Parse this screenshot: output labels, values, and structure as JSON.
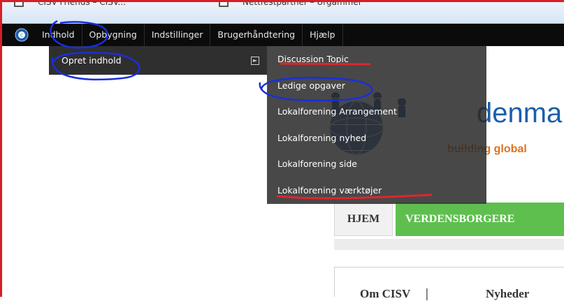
{
  "browser_tabs": [
    {
      "label": "CISV Friends – CISV..."
    },
    {
      "label": "Nettfestpartner – Urgammel"
    }
  ],
  "toolbar": {
    "items": [
      "Indhold",
      "Opbygning",
      "Indstillinger",
      "Brugerhåndtering",
      "Hjælp"
    ]
  },
  "dropdown1": {
    "item_label": "Opret indhold"
  },
  "dropdown2": {
    "items": [
      "Discussion Topic",
      "Ledige opgaver",
      "Lokalforening Arrangement",
      "Lokalforening nyhed",
      "Lokalforening side",
      "Lokalforening værktøjer"
    ]
  },
  "site": {
    "brand": "denmar",
    "tagline": "building global",
    "nav_home": "HJEM",
    "nav_verdensborgere": "VERDENSBORGERE",
    "link_om": "Om CISV",
    "separator": "|",
    "link_nyheder": "Nyheder"
  },
  "colors": {
    "annotation_blue": "#1a2fd9",
    "annotation_red": "#e0252b",
    "nav_green": "#5ebf4f",
    "brand_blue": "#1b5ea8",
    "tagline_orange": "#e0701e"
  }
}
